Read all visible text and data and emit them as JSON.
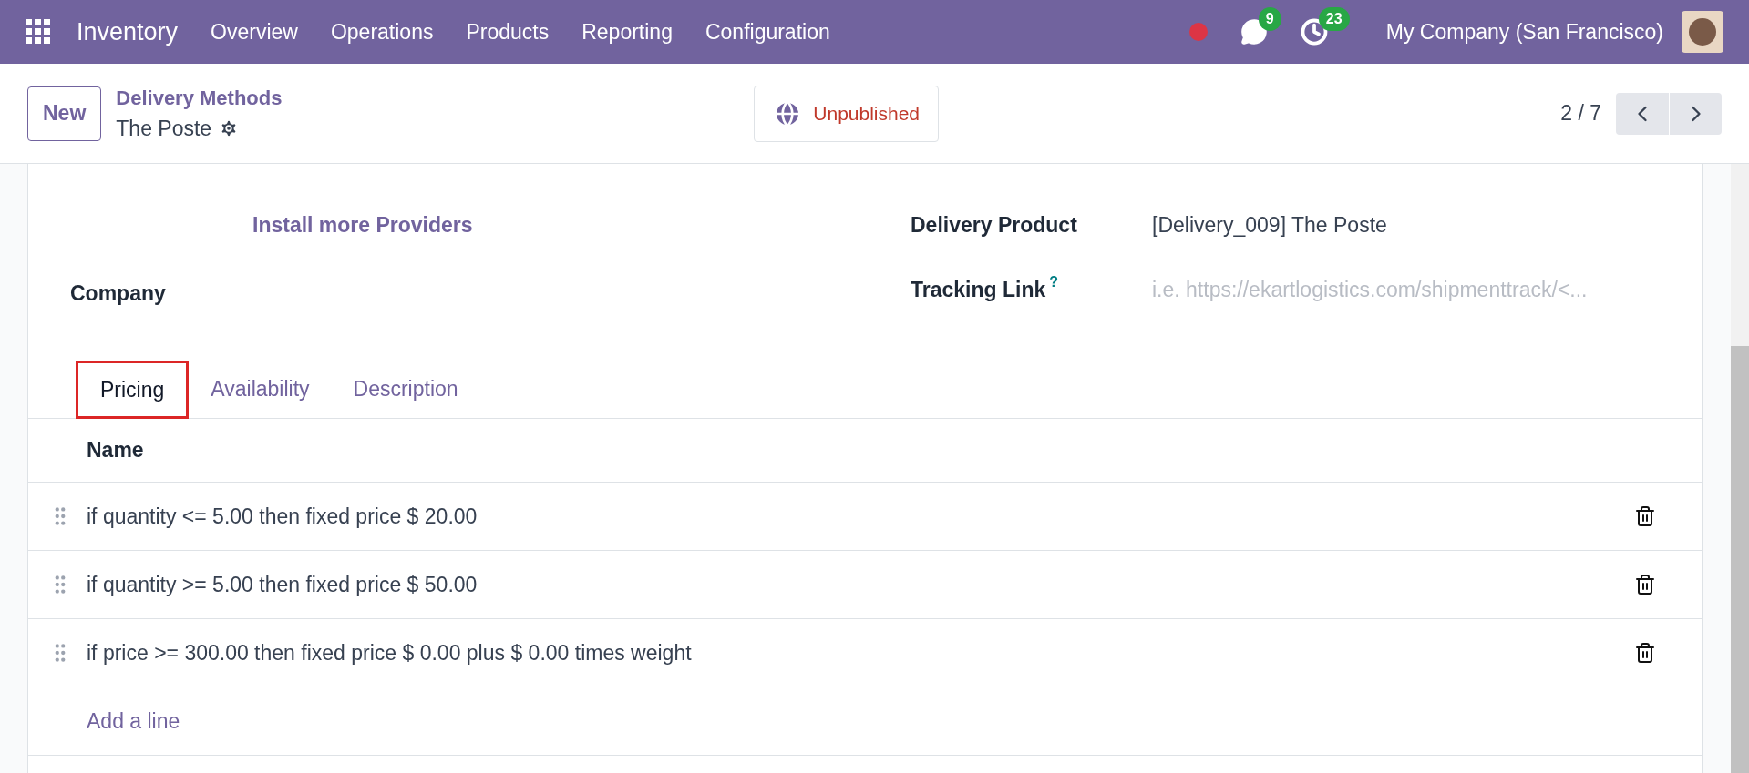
{
  "navbar": {
    "app": "Inventory",
    "menus": [
      "Overview",
      "Operations",
      "Products",
      "Reporting",
      "Configuration"
    ],
    "messages_count": "9",
    "activities_count": "23",
    "company": "My Company (San Francisco)"
  },
  "control_panel": {
    "new_button": "New",
    "breadcrumb": "Delivery Methods",
    "record": "The Poste",
    "publish_status": "Unpublished",
    "pager": "2 / 7"
  },
  "form": {
    "install_link": "Install more Providers",
    "company_label": "Company",
    "delivery_product_label": "Delivery Product",
    "delivery_product_value": "[Delivery_009] The Poste",
    "tracking_link_label": "Tracking Link",
    "tracking_help": "?",
    "tracking_link_placeholder": "i.e. https://ekartlogistics.com/shipmenttrack/<..."
  },
  "tabs": [
    {
      "label": "Pricing",
      "selected": true
    },
    {
      "label": "Availability",
      "selected": false
    },
    {
      "label": "Description",
      "selected": false
    }
  ],
  "table": {
    "columns": [
      "Name"
    ],
    "rows": [
      "if quantity <= 5.00 then fixed price $ 20.00",
      "if quantity >= 5.00 then fixed price $ 50.00",
      "if price >= 300.00 then fixed price $ 0.00 plus $ 0.00 times weight"
    ],
    "add_line": "Add a line"
  }
}
